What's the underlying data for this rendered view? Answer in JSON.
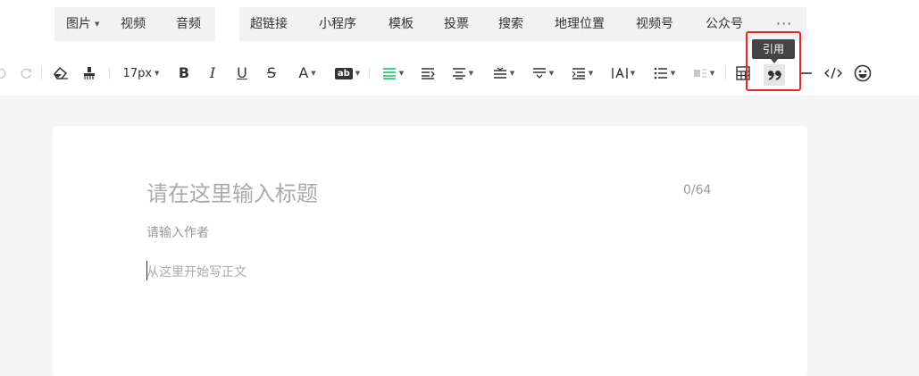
{
  "insert_bar": {
    "group1": [
      {
        "label": "图片",
        "has_caret": true
      },
      {
        "label": "视频"
      },
      {
        "label": "音频"
      }
    ],
    "group2": [
      {
        "label": "超链接"
      },
      {
        "label": "小程序"
      },
      {
        "label": "模板"
      },
      {
        "label": "投票"
      },
      {
        "label": "搜索"
      },
      {
        "label": "地理位置"
      },
      {
        "label": "视频号"
      },
      {
        "label": "公众号"
      }
    ],
    "more": "···"
  },
  "toolbar": {
    "font_size": "17px",
    "font_color_letter": "A",
    "bg_color_label": "ab",
    "active_tool": "quote",
    "tooltip": "引用",
    "accent_color": "#07c160",
    "highlight_color": "#e8232b",
    "icons": [
      "undo-icon",
      "redo-icon",
      "clear-format-icon",
      "format-brush-icon",
      "bold-icon",
      "italic-icon",
      "underline-icon",
      "strikethrough-icon",
      "font-color-icon",
      "background-color-icon",
      "align-left-icon",
      "indent-icon",
      "align-center-icon",
      "line-height-icon",
      "paragraph-spacing-icon",
      "margin-icon",
      "letter-spacing-icon",
      "list-icon",
      "image-float-icon",
      "table-icon",
      "quote-icon",
      "divider-icon",
      "code-icon",
      "emoji-icon"
    ]
  },
  "editor": {
    "title_placeholder": "请在这里输入标题",
    "title_count": "0/64",
    "author_placeholder": "请输入作者",
    "body_placeholder": "从这里开始写正文"
  }
}
